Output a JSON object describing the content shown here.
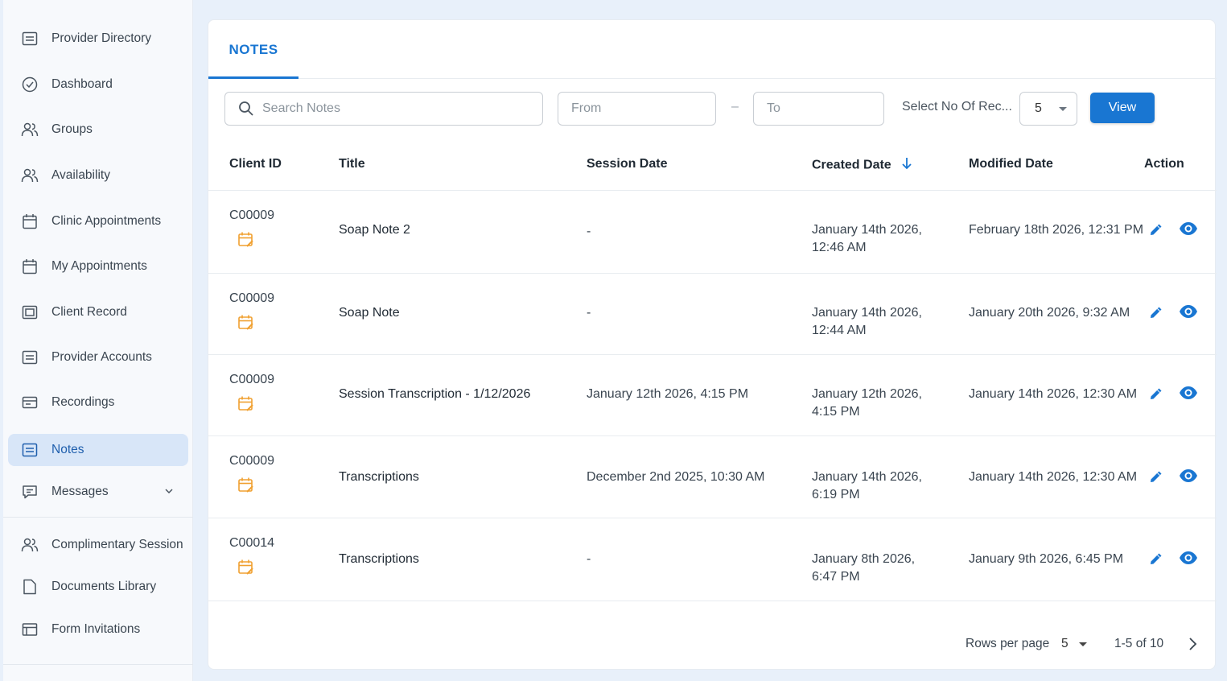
{
  "sidebar": {
    "items": [
      {
        "label": "Provider Directory",
        "icon": "list-box-icon"
      },
      {
        "label": "Dashboard",
        "icon": "check-circle-icon"
      },
      {
        "label": "Groups",
        "icon": "people-icon"
      },
      {
        "label": "Availability",
        "icon": "people-icon"
      },
      {
        "label": "Clinic Appointments",
        "icon": "calendar-icon"
      },
      {
        "label": "My Appointments",
        "icon": "calendar-icon"
      },
      {
        "label": "Client Record",
        "icon": "record-icon"
      },
      {
        "label": "Provider Accounts",
        "icon": "list-box-icon"
      },
      {
        "label": "Recordings",
        "icon": "recording-icon"
      },
      {
        "label": "Notes",
        "icon": "list-box-icon",
        "active": true
      },
      {
        "label": "Messages",
        "icon": "message-icon"
      }
    ],
    "secondary_items": [
      {
        "label": "Complimentary Session",
        "icon": "people-icon"
      },
      {
        "label": "Documents Library",
        "icon": "document-icon"
      },
      {
        "label": "Form Invitations",
        "icon": "form-icon"
      }
    ]
  },
  "tabs": {
    "notes": "NOTES"
  },
  "filters": {
    "search_placeholder": "Search Notes",
    "from_placeholder": "From",
    "separator": "–",
    "to_placeholder": "To",
    "records_label": "Select No Of Rec...",
    "records_value": "5",
    "view_label": "View"
  },
  "table": {
    "headers": {
      "client_id": "Client ID",
      "title": "Title",
      "session_date": "Session Date",
      "created_date": "Created Date",
      "modified_date": "Modified Date",
      "action": "Action"
    },
    "rows": [
      {
        "client_id": "C00009",
        "title": "Soap Note 2",
        "session_date": "-",
        "created_date": "January 14th 2026, 12:46 AM",
        "modified_date": "February 18th 2026, 12:31 PM"
      },
      {
        "client_id": "C00009",
        "title": "Soap Note",
        "session_date": "-",
        "created_date": "January 14th 2026, 12:44 AM",
        "modified_date": "January 20th 2026, 9:32 AM"
      },
      {
        "client_id": "C00009",
        "title": "Session Transcription - 1/12/2026",
        "session_date": "January 12th 2026, 4:15 PM",
        "created_date": "January 12th 2026, 4:15 PM",
        "modified_date": "January 14th 2026, 12:30 AM"
      },
      {
        "client_id": "C00009",
        "title": "Transcriptions",
        "session_date": "December 2nd 2025, 10:30 AM",
        "created_date": "January 14th 2026, 6:19 PM",
        "modified_date": "January 14th 2026, 12:30 AM"
      },
      {
        "client_id": "C00014",
        "title": "Transcriptions",
        "session_date": "-",
        "created_date": "January 8th 2026, 6:47 PM",
        "modified_date": "January 9th 2026, 6:45 PM"
      }
    ]
  },
  "pagination": {
    "rows_per_page_label": "Rows per page",
    "rows_per_page_value": "5",
    "range": "1-5 of 10"
  },
  "colors": {
    "accent": "#1976d2",
    "calendar_icon": "#f0a030",
    "active_bg": "#d8e6f8"
  }
}
